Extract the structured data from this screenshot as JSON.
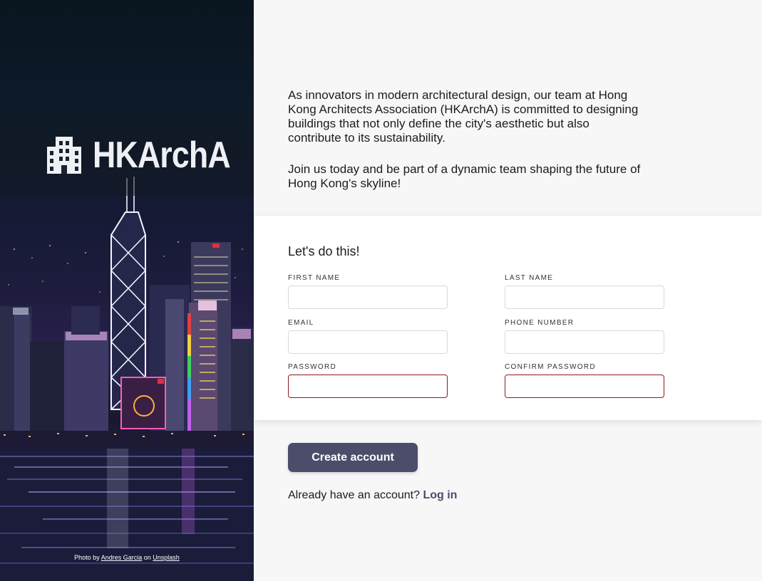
{
  "brand": {
    "name": "HKArchA",
    "logo_icon": "building-icon"
  },
  "hero": {
    "credit_prefix": "Photo by",
    "credit_author": "Andres Garcia",
    "credit_middle": "on",
    "credit_site": "Unsplash"
  },
  "intro": {
    "paragraph_1": "As innovators in modern architectural design, our team at Hong Kong Architects Association (HKArchA) is committed to designing buildings that not only define the city's aesthetic but also contribute to its sustainability.",
    "paragraph_2": "Join us today and be part of a dynamic team shaping the future of Hong Kong's skyline!"
  },
  "form": {
    "title": "Let's do this!",
    "first_name": {
      "label": "FIRST NAME",
      "value": ""
    },
    "last_name": {
      "label": "LAST NAME",
      "value": ""
    },
    "email": {
      "label": "EMAIL",
      "value": ""
    },
    "phone": {
      "label": "PHONE NUMBER",
      "value": ""
    },
    "password": {
      "label": "PASSWORD",
      "value": ""
    },
    "confirm_password": {
      "label": "CONFIRM PASSWORD",
      "value": ""
    }
  },
  "actions": {
    "create_label": "Create account",
    "login_prompt": "Already have an account?",
    "login_link": "Log in"
  },
  "colors": {
    "accent": "#4b4d6b",
    "invalid_border": "#8c1b1b",
    "background": "#f7f7f8"
  }
}
